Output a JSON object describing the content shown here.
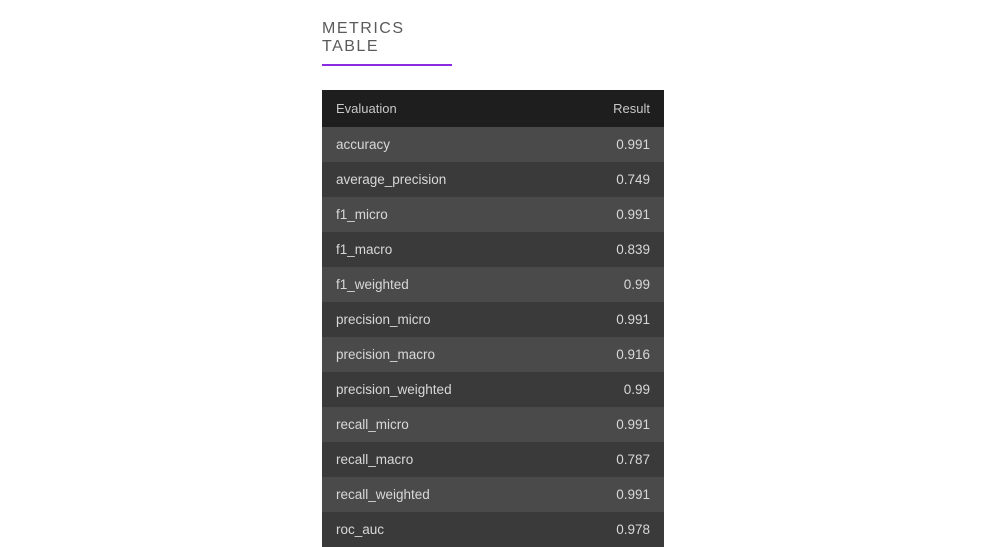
{
  "title": "METRICS TABLE",
  "table": {
    "headers": [
      "Evaluation",
      "Result"
    ],
    "rows": [
      {
        "metric": "accuracy",
        "value": "0.991"
      },
      {
        "metric": "average_precision",
        "value": "0.749"
      },
      {
        "metric": "f1_micro",
        "value": "0.991"
      },
      {
        "metric": "f1_macro",
        "value": "0.839"
      },
      {
        "metric": "f1_weighted",
        "value": "0.99"
      },
      {
        "metric": "precision_micro",
        "value": "0.991"
      },
      {
        "metric": "precision_macro",
        "value": "0.916"
      },
      {
        "metric": "precision_weighted",
        "value": "0.99"
      },
      {
        "metric": "recall_micro",
        "value": "0.991"
      },
      {
        "metric": "recall_macro",
        "value": "0.787"
      },
      {
        "metric": "recall_weighted",
        "value": "0.991"
      },
      {
        "metric": "roc_auc",
        "value": "0.978"
      }
    ]
  },
  "colors": {
    "accent": "#8a2be2",
    "header_bg": "#1e1e1e",
    "row_odd": "#4a4a4a",
    "row_even": "#3a3a3a"
  }
}
